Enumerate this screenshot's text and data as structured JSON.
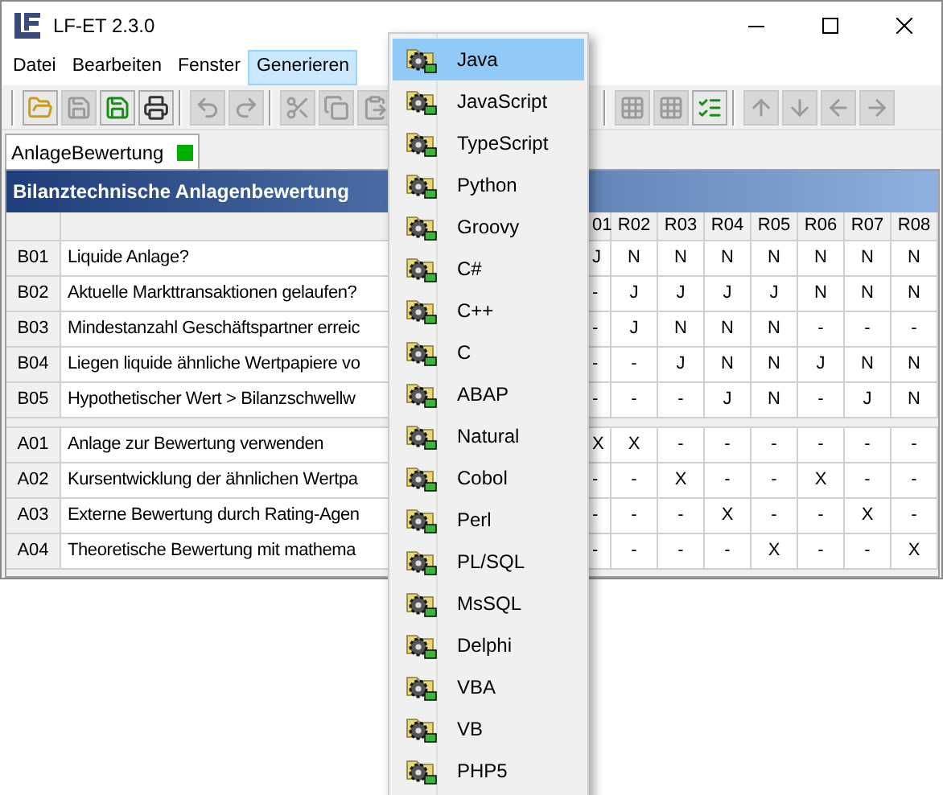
{
  "window": {
    "title": "LF-ET 2.3.0"
  },
  "menu_bar": [
    {
      "label": "Datei",
      "selected": false
    },
    {
      "label": "Bearbeiten",
      "selected": false
    },
    {
      "label": "Fenster",
      "selected": false
    },
    {
      "label": "Generieren",
      "selected": true
    }
  ],
  "toolbar": [
    [
      {
        "kind": "open",
        "disabled": false
      },
      {
        "kind": "save",
        "disabled": true
      },
      {
        "kind": "save-all",
        "disabled": false
      },
      {
        "kind": "print",
        "disabled": false
      }
    ],
    [
      {
        "kind": "undo",
        "disabled": true
      },
      {
        "kind": "redo",
        "disabled": true
      }
    ],
    [
      {
        "kind": "cut",
        "disabled": true
      },
      {
        "kind": "copy",
        "disabled": true
      },
      {
        "kind": "paste",
        "disabled": true
      }
    ],
    [
      {
        "kind": "grid",
        "disabled": true
      },
      {
        "kind": "grid",
        "disabled": true
      },
      {
        "kind": "check",
        "disabled": false
      }
    ],
    [
      {
        "kind": "up",
        "disabled": true
      },
      {
        "kind": "down",
        "disabled": true
      },
      {
        "kind": "left",
        "disabled": true
      },
      {
        "kind": "right",
        "disabled": true
      }
    ]
  ],
  "tab": {
    "label": "AnlageBewertung",
    "selected": true
  },
  "table": {
    "title": "Bilanztechnische Anlagenbewertung",
    "columns": [
      "01",
      "R02",
      "R03",
      "R04",
      "R05",
      "R06",
      "R07",
      "R08"
    ],
    "conditions": [
      {
        "id": "B01",
        "text": "Liquide Anlage?",
        "values": [
          "J",
          "N",
          "N",
          "N",
          "N",
          "N",
          "N",
          "N"
        ]
      },
      {
        "id": "B02",
        "text": "Aktuelle Markttransaktionen gelaufen?",
        "values": [
          "-",
          "J",
          "J",
          "J",
          "J",
          "N",
          "N",
          "N"
        ]
      },
      {
        "id": "B03",
        "text": "Mindestanzahl Geschäftspartner erreic",
        "values": [
          "-",
          "J",
          "N",
          "N",
          "N",
          "-",
          "-",
          "-"
        ]
      },
      {
        "id": "B04",
        "text": "Liegen liquide ähnliche Wertpapiere vo",
        "values": [
          "-",
          "-",
          "J",
          "N",
          "N",
          "J",
          "N",
          "N"
        ]
      },
      {
        "id": "B05",
        "text": "Hypothetischer Wert > Bilanzschwellw",
        "values": [
          "-",
          "-",
          "-",
          "J",
          "N",
          "-",
          "J",
          "N"
        ]
      }
    ],
    "actions": [
      {
        "id": "A01",
        "text": "Anlage zur Bewertung verwenden",
        "values": [
          "X",
          "X",
          "-",
          "-",
          "-",
          "-",
          "-",
          "-"
        ]
      },
      {
        "id": "A02",
        "text": "Kursentwicklung der ähnlichen Wertpa",
        "values": [
          "-",
          "-",
          "X",
          "-",
          "-",
          "X",
          "-",
          "-"
        ]
      },
      {
        "id": "A03",
        "text": "Externe Bewertung durch Rating-Agen",
        "values": [
          "-",
          "-",
          "-",
          "X",
          "-",
          "-",
          "X",
          "-"
        ]
      },
      {
        "id": "A04",
        "text": "Theoretische Bewertung mit mathema",
        "values": [
          "-",
          "-",
          "-",
          "-",
          "X",
          "-",
          "-",
          "X"
        ]
      }
    ]
  },
  "dropdown_menu": [
    {
      "label": "Java",
      "selected": true
    },
    {
      "label": "JavaScript",
      "selected": false
    },
    {
      "label": "TypeScript",
      "selected": false
    },
    {
      "label": "Python",
      "selected": false
    },
    {
      "label": "Groovy",
      "selected": false
    },
    {
      "label": "C#",
      "selected": false
    },
    {
      "label": "C++",
      "selected": false
    },
    {
      "label": "C",
      "selected": false
    },
    {
      "label": "ABAP",
      "selected": false
    },
    {
      "label": "Natural",
      "selected": false
    },
    {
      "label": "Cobol",
      "selected": false
    },
    {
      "label": "Perl",
      "selected": false
    },
    {
      "label": "PL/SQL",
      "selected": false
    },
    {
      "label": "MsSQL",
      "selected": false
    },
    {
      "label": "Delphi",
      "selected": false
    },
    {
      "label": "VBA",
      "selected": false
    },
    {
      "label": "VB",
      "selected": false
    },
    {
      "label": "PHP5",
      "selected": false
    }
  ]
}
